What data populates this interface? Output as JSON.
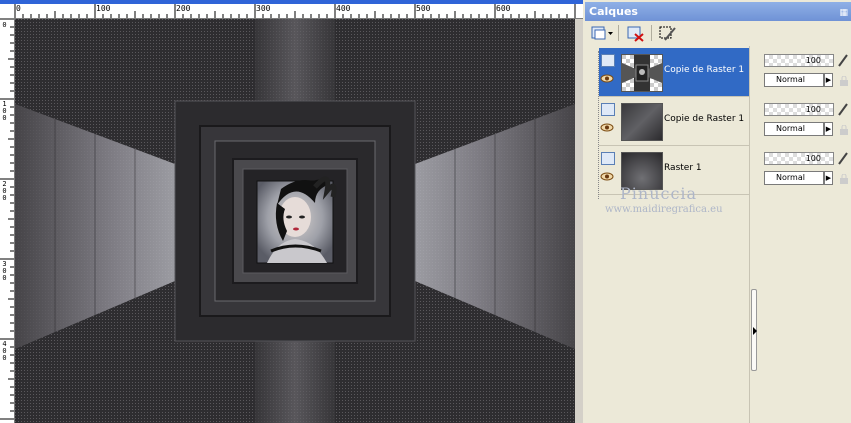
{
  "ruler": {
    "horizontal_labels": [
      "0",
      "100",
      "200",
      "300",
      "400",
      "500",
      "600"
    ],
    "vertical_labels": [
      "0",
      "1 0 0",
      "2 0 0",
      "3 0 0",
      "4 0 0"
    ]
  },
  "palette": {
    "title": "Calques"
  },
  "layers": [
    {
      "name": "Copie de Raster 1",
      "selected": true,
      "opacity": "100",
      "blend": "Normal"
    },
    {
      "name": "Copie de Raster 1",
      "selected": false,
      "opacity": "100",
      "blend": "Normal"
    },
    {
      "name": "Raster 1",
      "selected": false,
      "opacity": "100",
      "blend": "Normal"
    }
  ],
  "watermark": {
    "line1": "Pinuccia",
    "line2": "www.maidiregrafica.eu"
  },
  "colors": {
    "selection": "#316ac5",
    "title_bar": "#7a9ada",
    "ruler_blue": "#2f64d8"
  }
}
